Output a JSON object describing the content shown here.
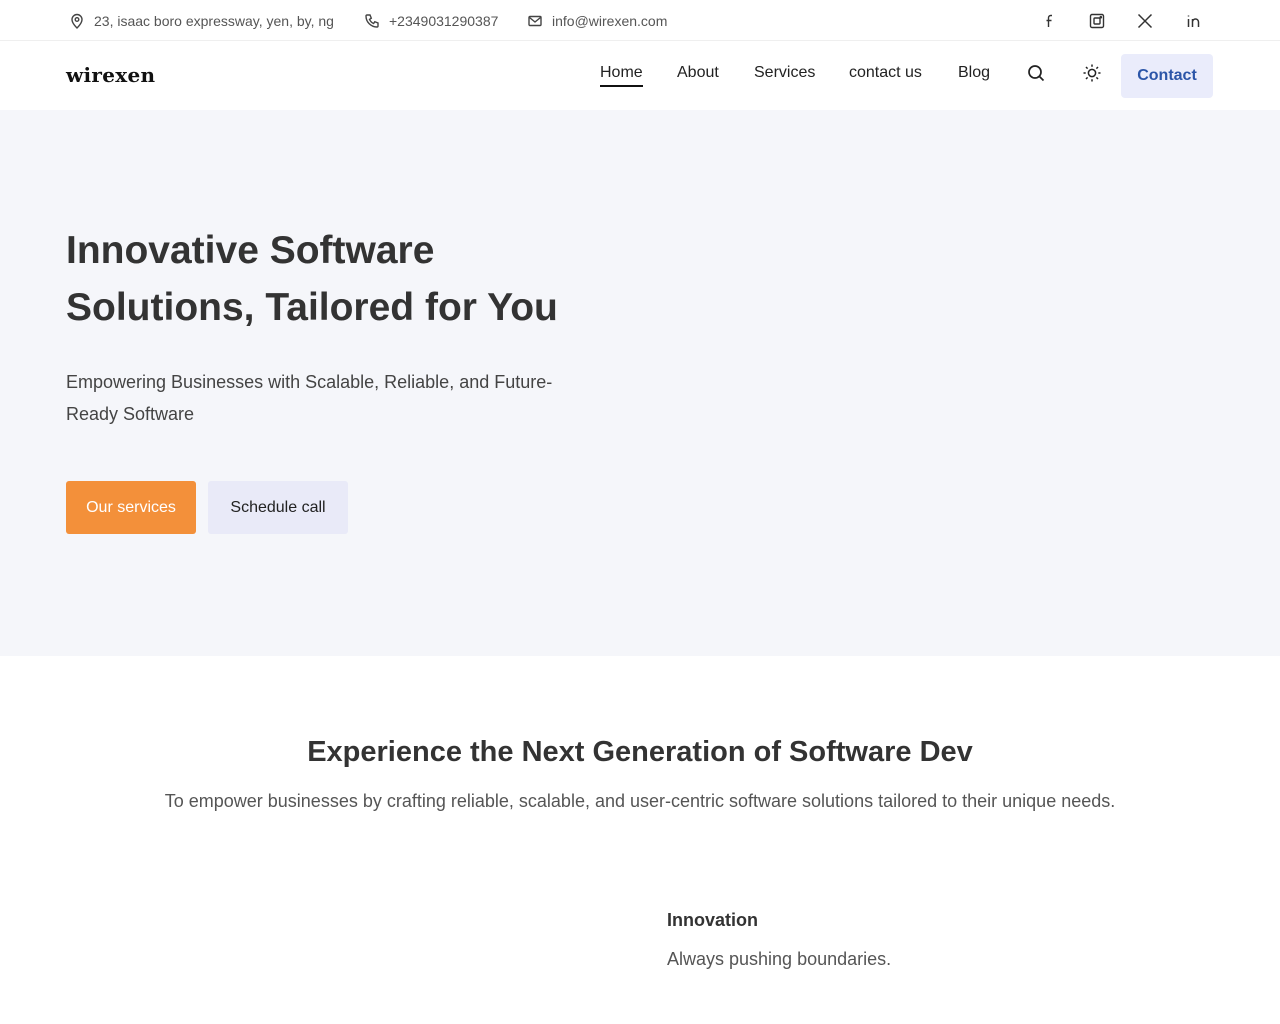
{
  "topbar": {
    "address": "23, isaac boro expressway, yen, by, ng",
    "phone": "+2349031290387",
    "email": "info@wirexen.com",
    "socials": [
      "facebook-icon",
      "instagram-icon",
      "x-icon",
      "linkedin-icon"
    ]
  },
  "nav": {
    "logo": "wirexen",
    "links": [
      "Home",
      "About",
      "Services",
      "contact us",
      "Blog"
    ],
    "active": "Home",
    "cta": "Contact"
  },
  "hero": {
    "title_line1": "Innovative Software",
    "title_line2": "Solutions, Tailored for You",
    "subtitle": "Empowering Businesses with Scalable, Reliable, and Future-Ready Software",
    "primary_button": "Our services",
    "secondary_button": "Schedule call"
  },
  "section2": {
    "title": "Experience the Next Generation of Software Dev",
    "text": "To empower businesses by crafting reliable, scalable, and user-centric software solutions tailored to their unique needs.",
    "feature": {
      "title": "Innovation",
      "text": "Always pushing boundaries."
    }
  },
  "colors": {
    "accent": "#f3903a",
    "cta_text": "#2b55a8",
    "hero_bg": "#f5f6fa"
  }
}
